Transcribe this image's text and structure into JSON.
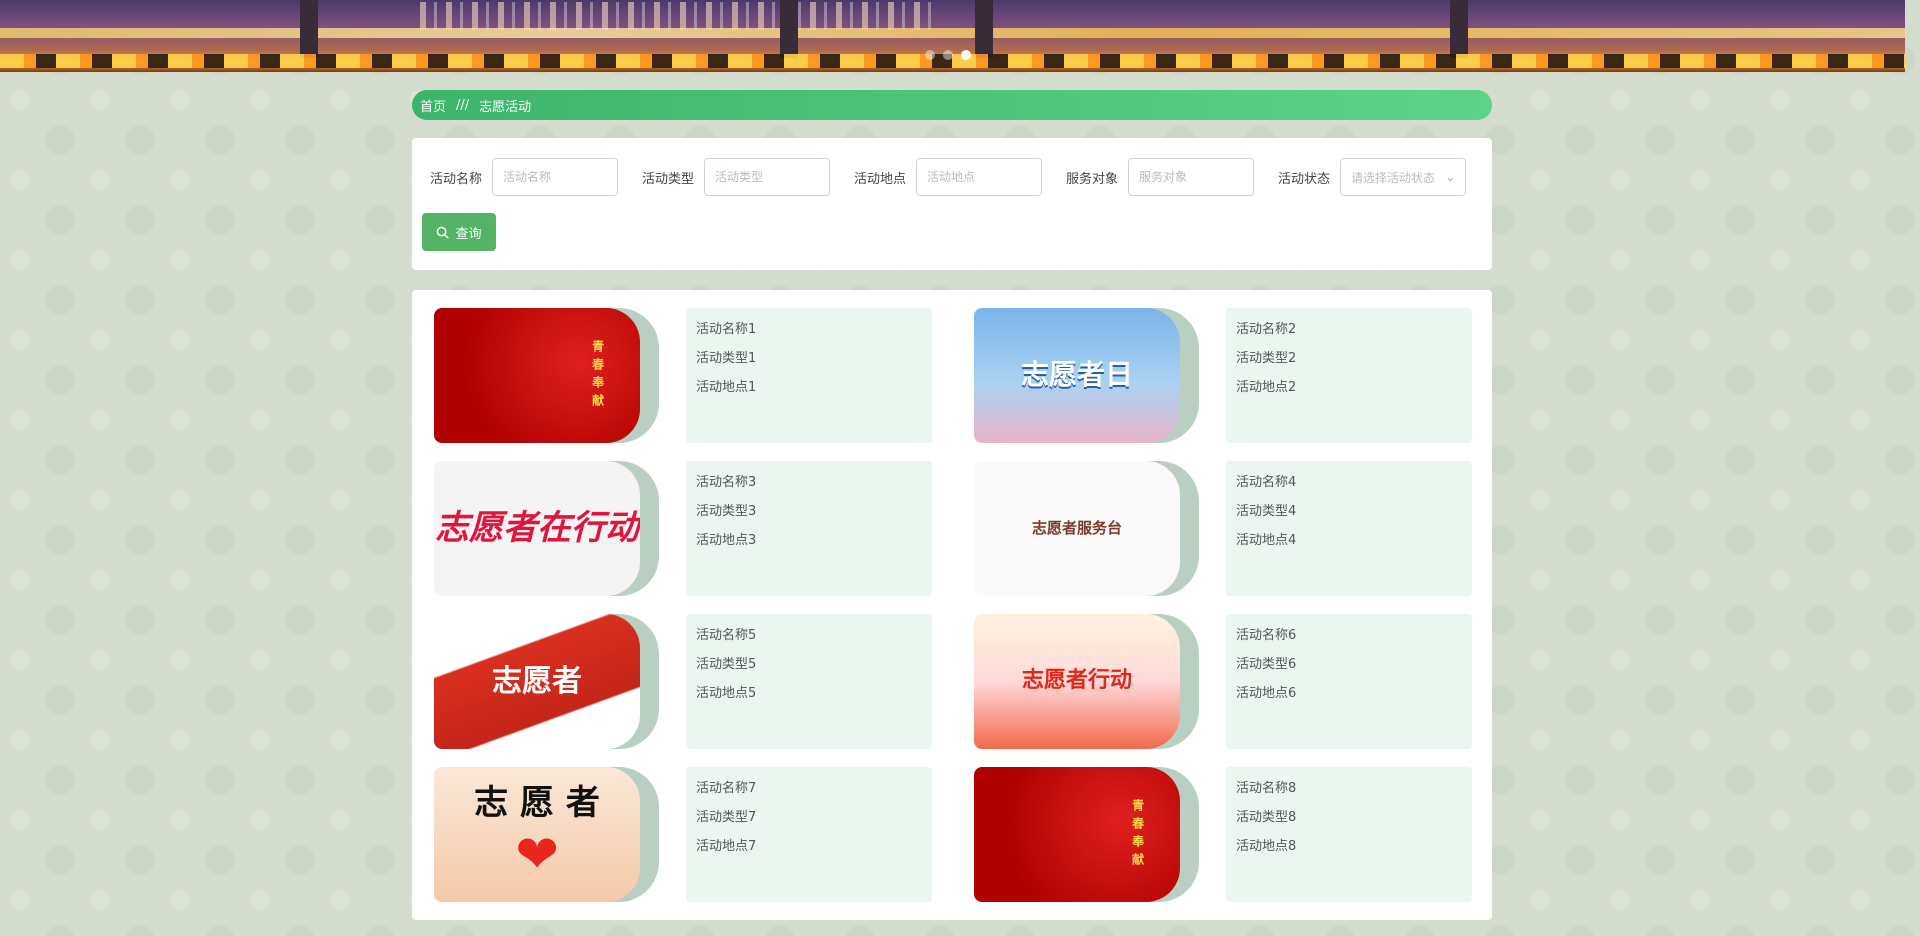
{
  "carousel": {
    "slide_count": 3,
    "active_index": 2
  },
  "breadcrumb": {
    "home": "首页",
    "separator": "///",
    "current": "志愿活动"
  },
  "search": {
    "activity_name": {
      "label": "活动名称",
      "placeholder": "活动名称",
      "value": ""
    },
    "activity_type": {
      "label": "活动类型",
      "placeholder": "活动类型",
      "value": ""
    },
    "activity_location": {
      "label": "活动地点",
      "placeholder": "活动地点",
      "value": ""
    },
    "service_target": {
      "label": "服务对象",
      "placeholder": "服务对象",
      "value": ""
    },
    "activity_status": {
      "label": "活动状态",
      "placeholder": "请选择活动状态"
    },
    "query_button": "查询"
  },
  "activities": [
    {
      "name": "活动名称1",
      "type": "活动类型1",
      "location": "活动地点1",
      "thumb_text": "青春奉献"
    },
    {
      "name": "活动名称2",
      "type": "活动类型2",
      "location": "活动地点2",
      "thumb_text": "志愿者日"
    },
    {
      "name": "活动名称3",
      "type": "活动类型3",
      "location": "活动地点3",
      "thumb_text": "志愿者在行动"
    },
    {
      "name": "活动名称4",
      "type": "活动类型4",
      "location": "活动地点4",
      "thumb_text": "志愿者服务台"
    },
    {
      "name": "活动名称5",
      "type": "活动类型5",
      "location": "活动地点5",
      "thumb_text": "志愿者"
    },
    {
      "name": "活动名称6",
      "type": "活动类型6",
      "location": "活动地点6",
      "thumb_text": "志愿者行动"
    },
    {
      "name": "活动名称7",
      "type": "活动类型7",
      "location": "活动地点7",
      "thumb_text": "志 愿 者"
    },
    {
      "name": "活动名称8",
      "type": "活动类型8",
      "location": "活动地点8",
      "thumb_text": "青春奉献"
    }
  ],
  "colors": {
    "accent": "#52b464",
    "breadcrumb_bg": "#3cb46a",
    "info_bg": "#eaf6ef"
  },
  "icons": {
    "query": "search-icon",
    "select": "chevron-down-icon",
    "carousel": "carousel-dot-icon"
  }
}
